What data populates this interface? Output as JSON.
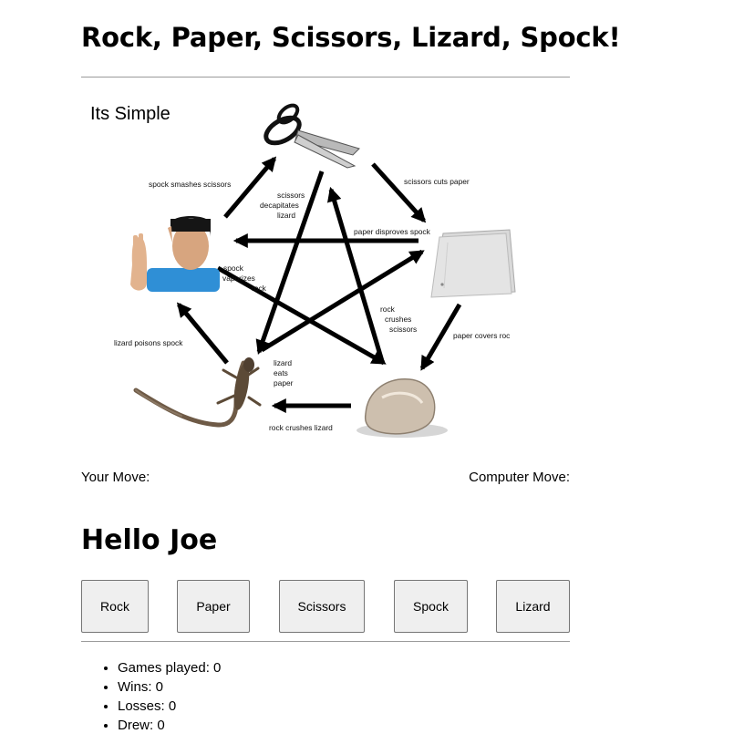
{
  "page": {
    "title": "Rock, Paper, Scissors, Lizard, Spock!",
    "greeting": "Hello Joe"
  },
  "diagram": {
    "heading": "Its Simple",
    "labels": {
      "spock_smashes_scissors": "spock smashes scissors",
      "scissors_cuts_paper": "scissors cuts paper",
      "scissors_decapitates_lizard": [
        "scissors",
        "decapitates",
        "lizard"
      ],
      "paper_disproves_spock": "paper disproves spock",
      "spock_vaporizes_rock": [
        "spock",
        "vaporizes",
        "rock"
      ],
      "rock_crushes_scissors": [
        "rock",
        "crushes",
        "scissors"
      ],
      "paper_covers_rock": "paper covers roc",
      "lizard_poisons_spock": "lizard poisons spock",
      "lizard_eats_paper": [
        "lizard",
        "eats",
        "paper"
      ],
      "rock_crushes_lizard": "rock crushes lizard"
    },
    "icons": [
      "scissors-icon",
      "paper-icon",
      "rock-icon",
      "lizard-icon",
      "spock-icon"
    ]
  },
  "moves": {
    "your_move_label": "Your Move:",
    "computer_move_label": "Computer Move:"
  },
  "buttons": {
    "rock": "Rock",
    "paper": "Paper",
    "scissors": "Scissors",
    "spock": "Spock",
    "lizard": "Lizard"
  },
  "stats": {
    "games_played": "Games played: 0",
    "wins": "Wins: 0",
    "losses": "Losses: 0",
    "drew": "Drew: 0"
  }
}
